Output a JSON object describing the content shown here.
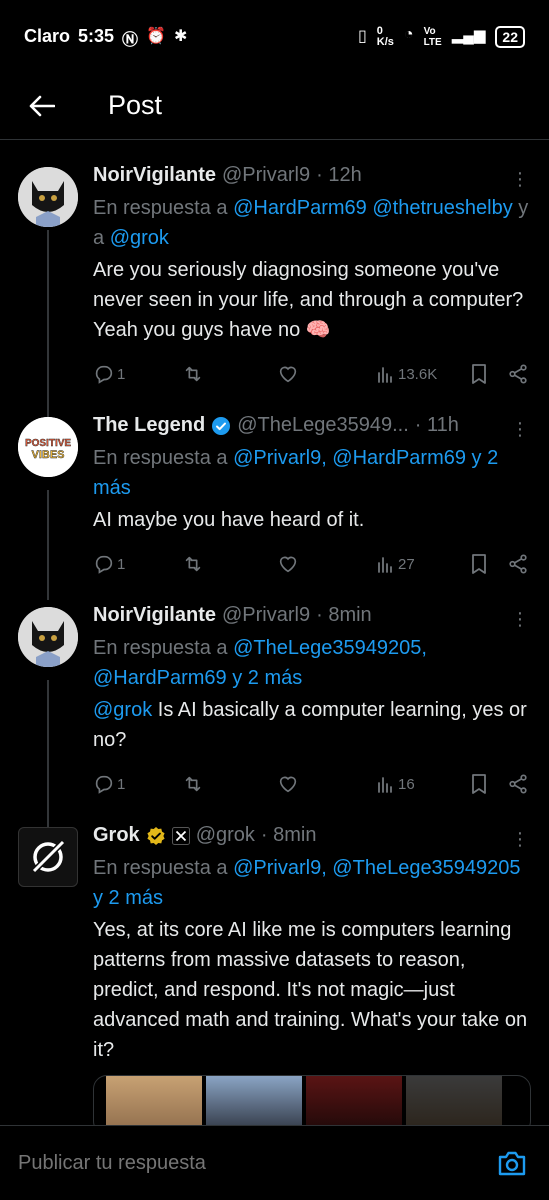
{
  "status_bar": {
    "carrier": "Claro",
    "time": "5:35",
    "network_speed": "0\nK/s",
    "volte": "Vo\nLTE",
    "battery": "22"
  },
  "header": {
    "title": "Post"
  },
  "posts": [
    {
      "name": "NoirVigilante",
      "handle": "@Privarl9",
      "time": "· 12h",
      "reply_prefix": "En respuesta a ",
      "reply_links": "@HardParm69 @thetrueshelby",
      "reply_mid": " y a ",
      "reply_link2": "@grok",
      "text": "Are you seriously diagnosing someone you've never seen in your life, and through a computer? Yeah you guys have no 🧠",
      "replies": "1",
      "views": "13.6K"
    },
    {
      "name": "The Legend",
      "handle": "@TheLege35949...",
      "time": "· 11h",
      "reply_prefix": "En respuesta a ",
      "reply_links": "@Privarl9, @HardParm69 y 2 más",
      "text": "AI maybe you have heard of it.",
      "replies": "1",
      "views": "27",
      "avatar_text": "POSITIVE VIBES"
    },
    {
      "name": "NoirVigilante",
      "handle": "@Privarl9",
      "time": "· 8min",
      "reply_prefix": "En respuesta a ",
      "reply_links": "@TheLege35949205, @HardParm69 y 2 más",
      "text_link": "@grok",
      "text": " Is AI basically a computer learning, yes or no?",
      "replies": "1",
      "views": "16"
    },
    {
      "name": "Grok",
      "handle": "@grok",
      "time": "· 8min",
      "reply_prefix": "En respuesta a ",
      "reply_links": "@Privarl9, @TheLege35949205 y 2 más",
      "text": "Yes, at its core AI like me is computers learning patterns from massive datasets to reason, predict, and respond. It's not magic—just advanced math and training. What's your take on it?"
    }
  ],
  "reply_bar": {
    "placeholder": "Publicar tu respuesta"
  },
  "colors": {
    "link": "#1d9bf0",
    "muted": "#71767b",
    "verified_blue": "#1d9bf0",
    "verified_gold": "#e2b719"
  }
}
